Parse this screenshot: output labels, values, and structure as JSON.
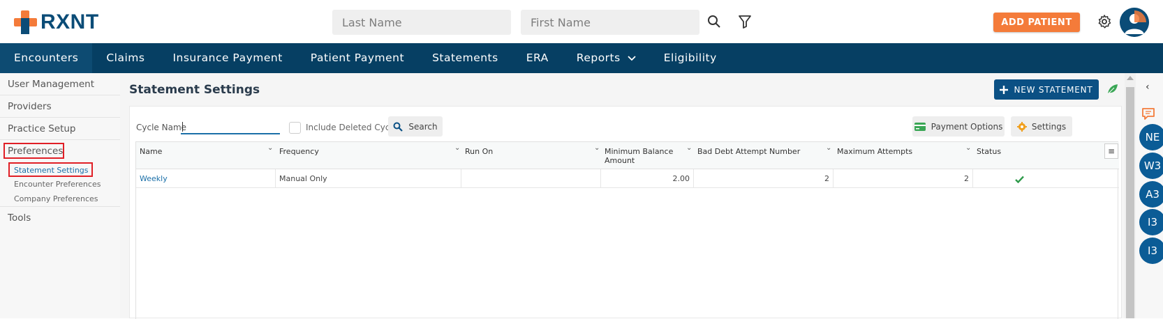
{
  "header": {
    "logo_text": "RXNT",
    "last_name_placeholder": "Last Name",
    "first_name_placeholder": "First Name",
    "add_patient_label": "ADD PATIENT",
    "brand_orange": "#f47b3a",
    "brand_navy": "#063f63"
  },
  "nav": {
    "items": [
      {
        "label": "Encounters"
      },
      {
        "label": "Claims"
      },
      {
        "label": "Insurance Payment"
      },
      {
        "label": "Patient Payment"
      },
      {
        "label": "Statements"
      },
      {
        "label": "ERA"
      },
      {
        "label": "Reports"
      },
      {
        "label": "Eligibility"
      }
    ]
  },
  "sidebar": {
    "items": [
      {
        "label": "User Management"
      },
      {
        "label": "Providers"
      },
      {
        "label": "Practice Setup"
      },
      {
        "label": "Preferences"
      },
      {
        "label": "Tools"
      }
    ],
    "sub_items": [
      {
        "label": "Statement Settings"
      },
      {
        "label": "Encounter Preferences"
      },
      {
        "label": "Company Preferences"
      }
    ]
  },
  "main": {
    "title": "Statement Settings",
    "new_statement_label": "NEW STATEMENT",
    "cycle_name_label": "Cycle Name",
    "cycle_name_value": "",
    "include_deleted_label": "Include Deleted Cycle",
    "search_label": "Search",
    "payment_options_label": "Payment Options",
    "settings_label": "Settings"
  },
  "table": {
    "columns": [
      "Name",
      "Frequency",
      "Run On",
      "Minimum Balance Amount",
      "Bad Debt Attempt Number",
      "Maximum Attempts",
      "Status"
    ],
    "rows": [
      {
        "name": "Weekly",
        "frequency": "Manual Only",
        "run_on": "",
        "min_balance": "2.00",
        "bad_debt": "2",
        "max_attempts": "2",
        "status": "active-check"
      }
    ]
  },
  "rail": {
    "bubbles": [
      "NE",
      "W3",
      "A3",
      "I3",
      "I3"
    ]
  }
}
